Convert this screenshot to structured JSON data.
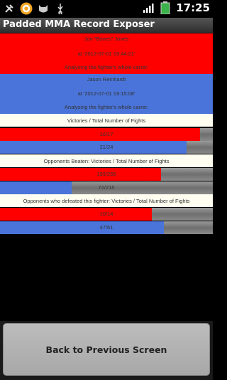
{
  "status_bar": {
    "time": "17:25",
    "icons": [
      "settings-tools-icon",
      "app-icon",
      "cat-icon",
      "usb-icon",
      "signal-icon",
      "battery-icon"
    ]
  },
  "app": {
    "title": "Padded MMA Record Exposer"
  },
  "fighter1": {
    "name": "Jon \"Bones\" Jones",
    "timestamp": "at '2012-07-01 19:44:21'",
    "status": "Analysing the fighter's whole carrer."
  },
  "fighter2": {
    "name": "Jason Reinhardt",
    "timestamp": "at '2012-07-01 19:15:08'",
    "status": "Analysing  the fighter's whole carrer."
  },
  "sections": [
    {
      "header": "Victories / Total Number of Fights",
      "bars": [
        {
          "label": "16/17",
          "fraction": 0.941,
          "color": "#ff0000"
        },
        {
          "label": "21/24",
          "fraction": 0.875,
          "color": "#4a74d9"
        }
      ]
    },
    {
      "header": "Opponents Beaten: Victories / Total Number of Fights",
      "bars": [
        {
          "label": "193/255",
          "fraction": 0.757,
          "color": "#ff0000"
        },
        {
          "label": "72/215",
          "fraction": 0.335,
          "color": "#4a74d9"
        }
      ]
    },
    {
      "header": "Opponents who defeated this fighter: Victories / Total Number of Fights",
      "bars": [
        {
          "label": "10/14",
          "fraction": 0.714,
          "color": "#ff0000"
        },
        {
          "label": "47/61",
          "fraction": 0.77,
          "color": "#4a74d9"
        }
      ]
    }
  ],
  "buttons": {
    "back_label": "Back to Previous Screen"
  },
  "colors": {
    "fighter1": "#ff0000",
    "fighter2": "#4a74d9",
    "background": "#000000"
  }
}
